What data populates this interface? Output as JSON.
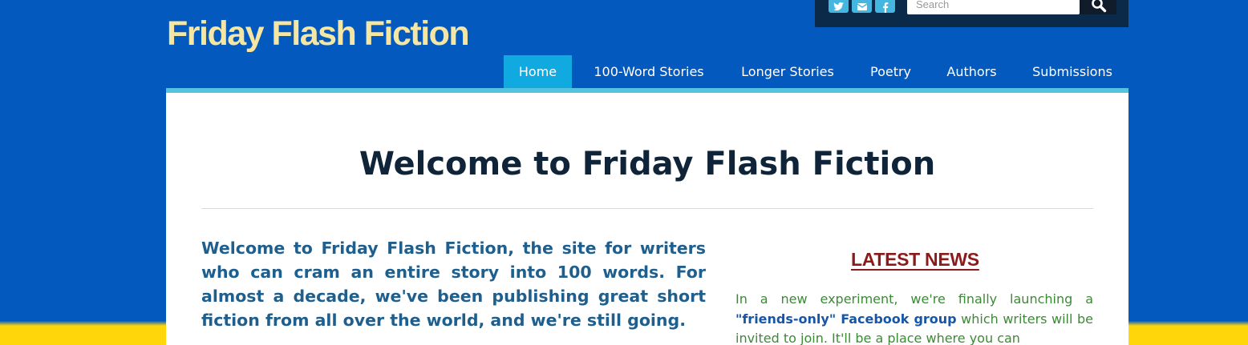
{
  "site": {
    "title": "Friday Flash Fiction"
  },
  "topbar": {
    "social": [
      {
        "name": "twitter-icon"
      },
      {
        "name": "email-icon"
      },
      {
        "name": "facebook-icon"
      }
    ],
    "search_placeholder": "Search"
  },
  "nav": {
    "items": [
      {
        "label": "Home",
        "active": true
      },
      {
        "label": "100-Word Stories",
        "active": false
      },
      {
        "label": "Longer Stories",
        "active": false
      },
      {
        "label": "Poetry",
        "active": false
      },
      {
        "label": "Authors",
        "active": false
      },
      {
        "label": "Submissions",
        "active": false
      }
    ]
  },
  "main": {
    "title": "Welcome to Friday Flash Fiction",
    "intro": "Welcome to Friday Flash Fiction, the site for writers who can cram an entire story into 100 words. For almost a decade, we've been publishing great short fiction from all over the world, and we're still going.",
    "news_heading": "LATEST NEWS",
    "news_before": "In a new experiment, we're finally launching a ",
    "news_link": "\"friends-only\" Facebook group",
    "news_after": " which writers will be invited to join. It'll be a place where you can"
  },
  "colors": {
    "page_background": "#0359bd",
    "title_color": "#f5e6a4",
    "nav_active": "#10a9e0",
    "heading": "#0f2438",
    "intro_text": "#1f5f8e",
    "news_heading": "#8b1a1a",
    "news_text": "#3b8a35",
    "news_link": "#1656a8",
    "accent_band": "#ffd60a"
  }
}
